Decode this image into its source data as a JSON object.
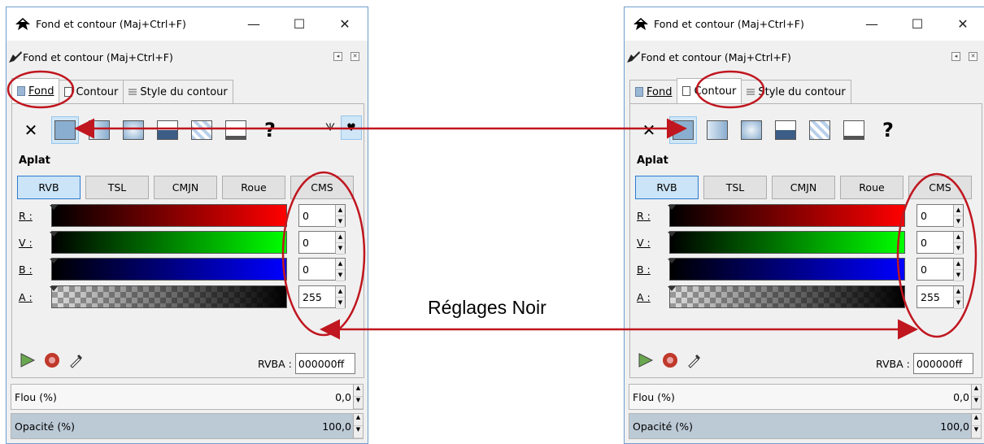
{
  "colors": {
    "accent": "#2b7bd0",
    "annotation": "#c0161f"
  },
  "left_window": {
    "title": "Fond et contour (Maj+Ctrl+F)",
    "dock_title": "Fond et contour (Maj+Ctrl+F)",
    "tabs": [
      {
        "label": "Fond",
        "icon": "fill-tab-icon",
        "active": true
      },
      {
        "label": "Contour",
        "icon": "stroke-tab-icon",
        "active": false
      },
      {
        "label": "Style du contour",
        "icon": "stroke-style-tab-icon",
        "active": false
      }
    ],
    "section": "Aplat",
    "modes": [
      "RVB",
      "TSL",
      "CMJN",
      "Roue",
      "CMS"
    ],
    "sliders": [
      {
        "label": "R",
        "value": "0"
      },
      {
        "label": "V",
        "value": "0"
      },
      {
        "label": "B",
        "value": "0"
      },
      {
        "label": "A",
        "value": "255"
      }
    ],
    "rvba_label": "RVBA",
    "rvba_value": "000000ff",
    "blur_label": "Flou (%)",
    "blur_value": "0,0",
    "opacity_label": "Opacité (%)",
    "opacity_value": "100,0"
  },
  "right_window": {
    "title": "Fond et contour (Maj+Ctrl+F)",
    "dock_title": "Fond et contour (Maj+Ctrl+F)",
    "tabs": [
      {
        "label": "Fond",
        "icon": "fill-tab-icon",
        "active": false
      },
      {
        "label": "Contour",
        "icon": "stroke-tab-icon",
        "active": true
      },
      {
        "label": "Style du contour",
        "icon": "stroke-style-tab-icon",
        "active": false
      }
    ],
    "section": "Aplat",
    "modes": [
      "RVB",
      "TSL",
      "CMJN",
      "Roue",
      "CMS"
    ],
    "sliders": [
      {
        "label": "R",
        "value": "0"
      },
      {
        "label": "V",
        "value": "0"
      },
      {
        "label": "B",
        "value": "0"
      },
      {
        "label": "A",
        "value": "255"
      }
    ],
    "rvba_label": "RVBA",
    "rvba_value": "000000ff",
    "blur_label": "Flou (%)",
    "blur_value": "0,0",
    "opacity_label": "Opacité (%)",
    "opacity_value": "100,0"
  },
  "annotation": {
    "label": "Réglages Noir"
  }
}
